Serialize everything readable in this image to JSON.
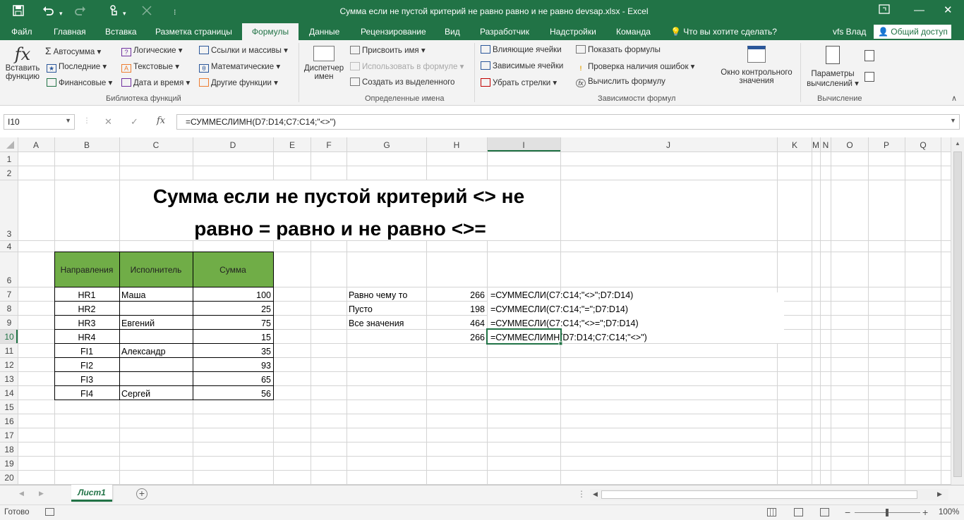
{
  "quick_access": {
    "save_icon": "save-icon",
    "undo_icon": "undo-icon",
    "redo_icon": "redo-icon",
    "touch_icon": "touch-mode-icon",
    "customize_icon": "customize-icon"
  },
  "window": {
    "title": "Сумма если не пустой критерий  не равно  равно и не равно  devsap.xlsx - Excel",
    "restore_icon": "restore-icon",
    "minimize": "—",
    "maximize": "❐",
    "close": "✕"
  },
  "ribbon_tabs": [
    "Файл",
    "Главная",
    "Вставка",
    "Разметка страницы",
    "Формулы",
    "Данные",
    "Рецензирование",
    "Вид",
    "Разработчик",
    "Надстройки",
    "Команда"
  ],
  "tell_me": "Что вы хотите сделать?",
  "user": "vfs Влад",
  "share": "Общий доступ",
  "ribbon": {
    "insert_function": [
      "Вставить",
      "функцию"
    ],
    "autosum": "Автосумма",
    "recent": "Последние",
    "financial": "Финансовые",
    "logical": "Логические",
    "text": "Текстовые",
    "datetime": "Дата и время",
    "lookup": "Ссылки и массивы",
    "math": "Математические",
    "other": "Другие функции",
    "group1": "Библиотека функций",
    "name_manager": [
      "Диспетчер",
      "имен"
    ],
    "define_name": "Присвоить имя",
    "use_in_formula": "Использовать в формуле",
    "create_from_sel": "Создать из выделенного",
    "group2": "Определенные имена",
    "trace_precedents": "Влияющие ячейки",
    "trace_dependents": "Зависимые ячейки",
    "remove_arrows": "Убрать стрелки",
    "show_formulas": "Показать формулы",
    "error_checking": "Проверка наличия ошибок",
    "evaluate_formula": "Вычислить формулу",
    "group3": "Зависимости формул",
    "watch_window": [
      "Окно контрольного",
      "значения"
    ],
    "calc_options": [
      "Параметры",
      "вычислений"
    ],
    "group4": "Вычисление"
  },
  "formula_bar": {
    "name_box": "I10",
    "cancel": "✕",
    "enter": "✓",
    "fx": "fx",
    "formula": "=СУММЕСЛИМН(D7:D14;C7:C14;\"<>\")"
  },
  "columns": [
    "A",
    "B",
    "C",
    "D",
    "E",
    "F",
    "G",
    "H",
    "I",
    "J",
    "K",
    "M",
    "N",
    "O",
    "P",
    "Q"
  ],
  "rows": [
    "1",
    "2",
    "3",
    "4",
    "6",
    "7",
    "8",
    "9",
    "10",
    "11",
    "12",
    "13",
    "14",
    "15",
    "16",
    "17",
    "18",
    "19",
    "20"
  ],
  "sheet_title": [
    "Сумма если не пустой критерий <> не",
    "равно = равно и не равно <>="
  ],
  "table": {
    "headers": [
      "Направления",
      "Исполнитель",
      "Сумма"
    ],
    "rows": [
      [
        "HR1",
        "Маша",
        "100"
      ],
      [
        "HR2",
        "",
        "25"
      ],
      [
        "HR3",
        "Евгений",
        "75"
      ],
      [
        "HR4",
        "",
        "15"
      ],
      [
        "FI1",
        "Александр",
        "35"
      ],
      [
        "FI2",
        "",
        "93"
      ],
      [
        "FI3",
        "",
        "65"
      ],
      [
        "FI4",
        "Сергей",
        "56"
      ]
    ]
  },
  "summary": [
    {
      "label": "Равно чему то",
      "value": "266",
      "formula": "=СУММЕСЛИ(C7:C14;\"<>\";D7:D14)"
    },
    {
      "label": "Пусто",
      "value": "198",
      "formula": "=СУММЕСЛИ(C7:C14;\"=\";D7:D14)"
    },
    {
      "label": "Все значения",
      "value": "464",
      "formula": "=СУММЕСЛИ(C7:C14;\"<>=\";D7:D14)"
    },
    {
      "label": "",
      "value": "266",
      "formula": "=СУММЕСЛИМН(D7:D14;C7:C14;\"<>\")"
    }
  ],
  "sheet_tab": "Лист1",
  "add_sheet": "+",
  "status": {
    "ready": "Готово",
    "zoom": "100%",
    "zoom_minus": "−",
    "zoom_plus": "+"
  },
  "colors": {
    "excel_green": "#217346",
    "header_fill": "#70ad47",
    "selection": "#217346"
  }
}
